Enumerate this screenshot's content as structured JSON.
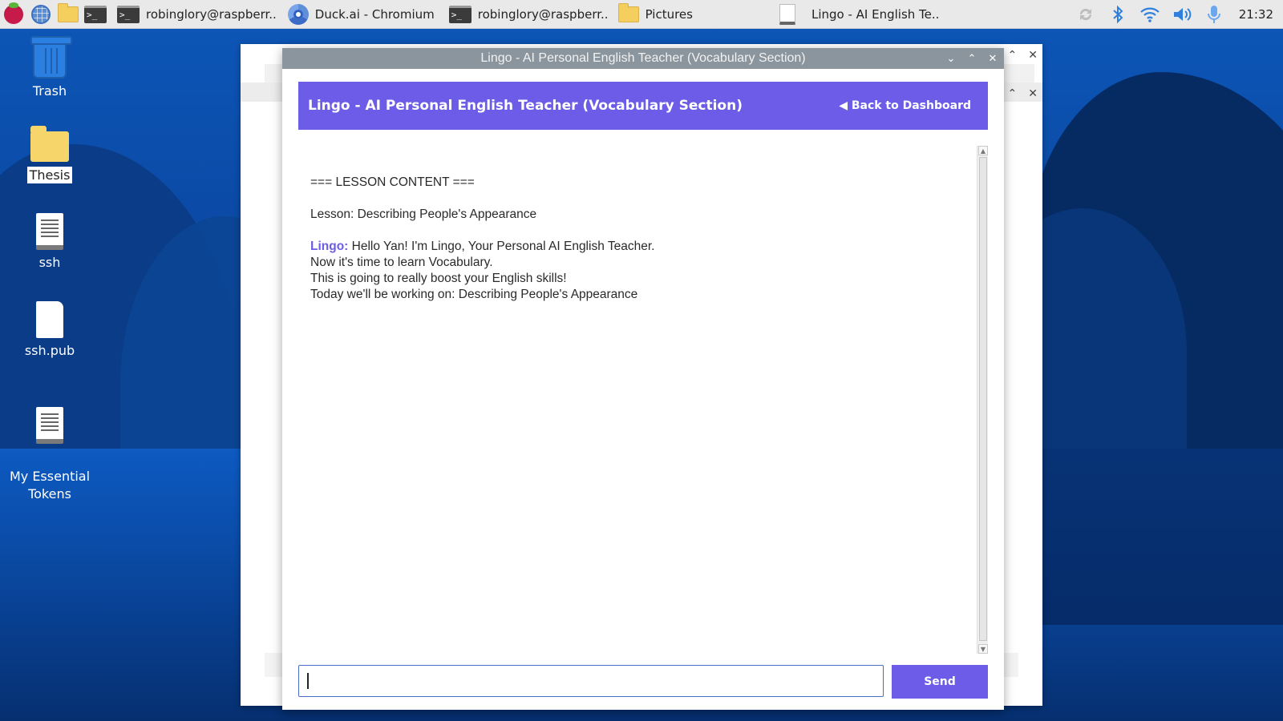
{
  "taskbar": {
    "tasks": [
      {
        "label": "robinglory@raspberr.."
      },
      {
        "label": "Duck.ai - Chromium"
      },
      {
        "label": "robinglory@raspberr.."
      },
      {
        "label": "Pictures"
      },
      {
        "label": "Lingo - AI English Te.."
      }
    ],
    "clock": "21:32"
  },
  "desktop": {
    "icons": [
      {
        "label": "Trash"
      },
      {
        "label": "Thesis"
      },
      {
        "label": "ssh"
      },
      {
        "label": "ssh.pub"
      },
      {
        "label": "My Essential\nTokens"
      }
    ]
  },
  "window": {
    "title": "Lingo - AI Personal English Teacher (Vocabulary Section)",
    "header_title": "Lingo - AI Personal English Teacher (Vocabulary Section)",
    "back_label": "◀ Back to Dashboard",
    "content": {
      "heading": "=== LESSON CONTENT ===",
      "lesson_line": "Lesson: Describing People's Appearance",
      "speaker": "Lingo:",
      "lines": [
        " Hello Yan! I'm Lingo, Your Personal AI English Teacher.",
        "Now it's time to learn Vocabulary.",
        "This is going to really boost your English skills!",
        "Today we'll be working on: Describing People's Appearance"
      ]
    },
    "input": {
      "value": "",
      "placeholder": ""
    },
    "send_label": "Send"
  },
  "colors": {
    "accent": "#6c5ce7",
    "titlebar": "#8a959e",
    "taskbar": "#e9e9e9"
  }
}
